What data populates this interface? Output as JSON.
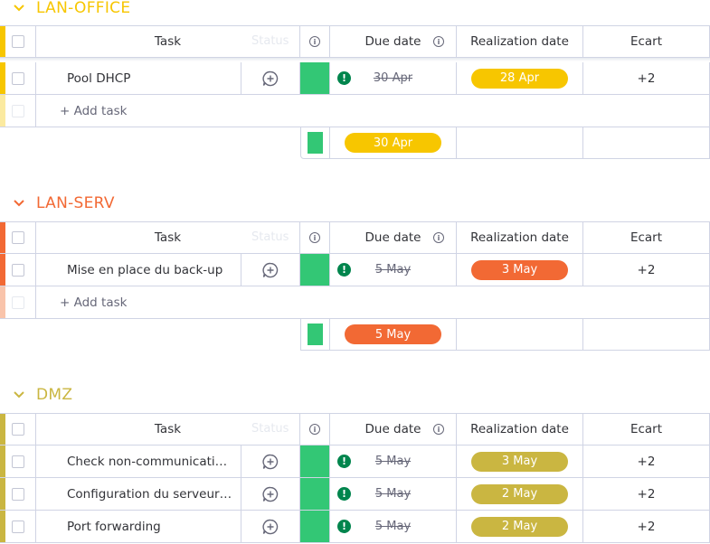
{
  "columns": {
    "task": "Task",
    "status": "Status",
    "due": "Due date",
    "realization": "Realization date",
    "ecart": "Ecart"
  },
  "add_task_label": "+ Add task",
  "groups": [
    {
      "name": "LAN-OFFICE",
      "color": "#f7c600",
      "light": "#fbeaa0",
      "pill_color": "#f7c600",
      "rows": [
        {
          "task": "Pool DHCP",
          "due": "30 Apr",
          "realization": "28 Apr",
          "ecart": "+2"
        }
      ],
      "summary": {
        "realization": "30 Apr"
      }
    },
    {
      "name": "LAN-SERV",
      "color": "#f26934",
      "light": "#f9c4ab",
      "pill_color": "#f26934",
      "rows": [
        {
          "task": "Mise en place du back-up",
          "due": "5 May",
          "realization": "3 May",
          "ecart": "+2"
        }
      ],
      "summary": {
        "realization": "5 May"
      }
    },
    {
      "name": "DMZ",
      "color": "#cab641",
      "light": "#e8dfa6",
      "pill_color": "#cab641",
      "rows": [
        {
          "task": "Check non-communication…",
          "due": "5 May",
          "realization": "3 May",
          "ecart": "+2"
        },
        {
          "task": "Configuration du serveur …",
          "due": "5 May",
          "realization": "2 May",
          "ecart": "+2"
        },
        {
          "task": "Port forwarding",
          "due": "5 May",
          "realization": "2 May",
          "ecart": "+2"
        }
      ]
    }
  ]
}
